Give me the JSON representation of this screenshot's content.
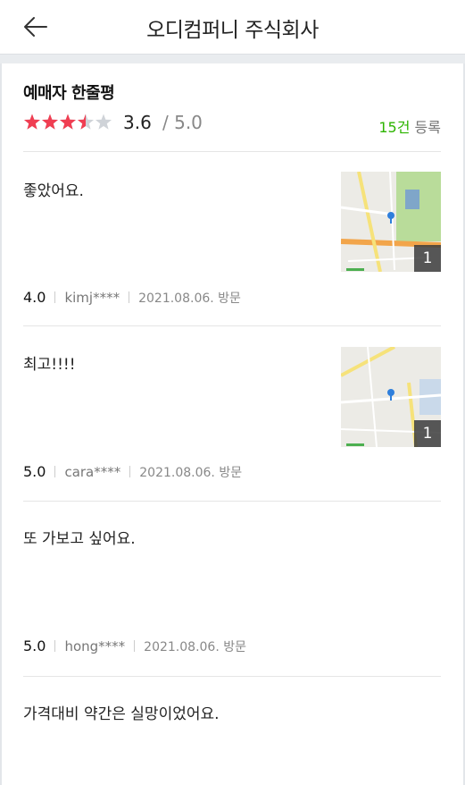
{
  "header": {
    "title": "오디컴퍼니 주식회사",
    "back_icon": "arrow-left-icon"
  },
  "summary": {
    "title": "예매자 한줄평",
    "rating": 3.6,
    "rating_text": "3.6",
    "max_text": "/ 5.0",
    "count_number": "15건",
    "count_suffix": " 등록",
    "star_color": "#f03e52",
    "count_color": "#2db400"
  },
  "reviews": [
    {
      "text": "좋았어요.",
      "score": "4.0",
      "user": "kimj****",
      "date": "2021.08.06. 방문",
      "photo_count": "1"
    },
    {
      "text": "최고!!!!",
      "score": "5.0",
      "user": "cara****",
      "date": "2021.08.06. 방문",
      "photo_count": "1"
    },
    {
      "text": "또 가보고 싶어요.",
      "score": "5.0",
      "user": "hong****",
      "date": "2021.08.06. 방문"
    },
    {
      "text": "가격대비 약간은 실망이었어요."
    }
  ]
}
